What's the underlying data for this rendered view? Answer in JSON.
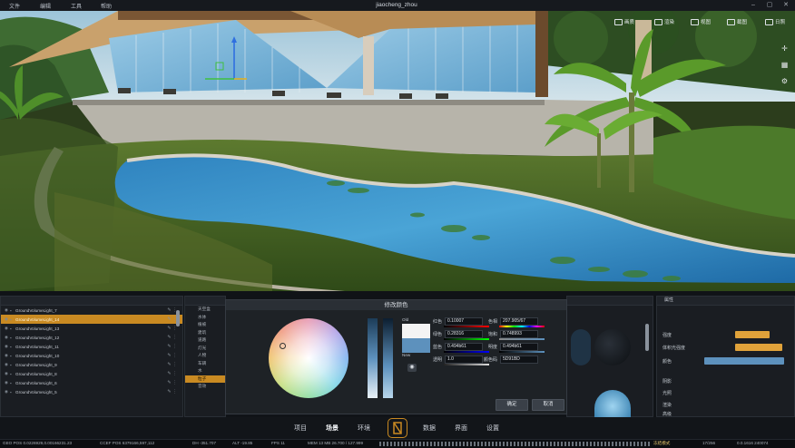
{
  "app": {
    "menus": [
      "文件",
      "编辑",
      "工具",
      "帮助"
    ],
    "user": "jiaocheng_zhou"
  },
  "viewport_toolbar": [
    "画质",
    "渲染",
    "视图",
    "截图",
    "日照"
  ],
  "layer_panel": {
    "rows": [
      {
        "label": "GroundVolumeLight_7",
        "selected": false
      },
      {
        "label": "GroundVolumeLight_14",
        "selected": true
      },
      {
        "label": "GroundVolumeLight_13",
        "selected": false
      },
      {
        "label": "GroundVolumeLight_12",
        "selected": false
      },
      {
        "label": "GroundVolumeLight_11",
        "selected": false
      },
      {
        "label": "GroundVolumeLight_10",
        "selected": false
      },
      {
        "label": "GroundVolumeLight_9",
        "selected": false
      },
      {
        "label": "GroundVolumeLight_8",
        "selected": false
      },
      {
        "label": "GroundVolumeLight_6",
        "selected": false
      },
      {
        "label": "GroundVolumeLight_5",
        "selected": false
      }
    ]
  },
  "tree_panel": {
    "rows": [
      "天空盒",
      "水体",
      "植被",
      "建筑",
      "道路",
      "灯光",
      "人物",
      "车辆",
      "水",
      "粒子",
      "音效"
    ],
    "selected_index": 9
  },
  "color_dialog": {
    "title": "修改颜色",
    "old_label": "Old",
    "new_label": "New",
    "fields_left": [
      {
        "label": "红色",
        "value": "0.10007"
      },
      {
        "label": "绿色",
        "value": "0.28316"
      },
      {
        "label": "蓝色",
        "value": "0.494b61"
      },
      {
        "label": "透明",
        "value": "1.0"
      }
    ],
    "fields_right": [
      {
        "label": "色相",
        "value": "207.905/67"
      },
      {
        "label": "饱和",
        "value": "0.748993"
      },
      {
        "label": "明度",
        "value": "0.494b61"
      },
      {
        "label": "颜色码",
        "value": "5D91BD"
      }
    ],
    "ok": "确定",
    "cancel": "取消",
    "new_color": "#5d91bd",
    "old_color": "#f4f4f4"
  },
  "right_panel": {
    "title": "属性",
    "rows": [
      {
        "label": "强度"
      },
      {
        "label": "体积光强度"
      },
      {
        "label": "颜色"
      }
    ],
    "collapsed": [
      "阴影",
      "光照",
      "渲染",
      "高级"
    ]
  },
  "bottom_nav": {
    "items": [
      "项目",
      "场景",
      "环境",
      "数据",
      "界面",
      "设置"
    ],
    "active": "场景"
  },
  "status_bar": {
    "items": [
      "GEO POS  0.0226929,0.00166231.23",
      "CCEF POS  6379166,597,112",
      "DH  -351.707",
      "ALT  -19.85",
      "FPS  11",
      "MEM  13 MB  26.700 / 127.999",
      "17/256",
      "0.0.1616 240074"
    ],
    "mode": "冻结模式"
  },
  "colors": {
    "accent": "#c98a22",
    "panel_bg": "#1a1d22",
    "water": "#3f92c8"
  }
}
